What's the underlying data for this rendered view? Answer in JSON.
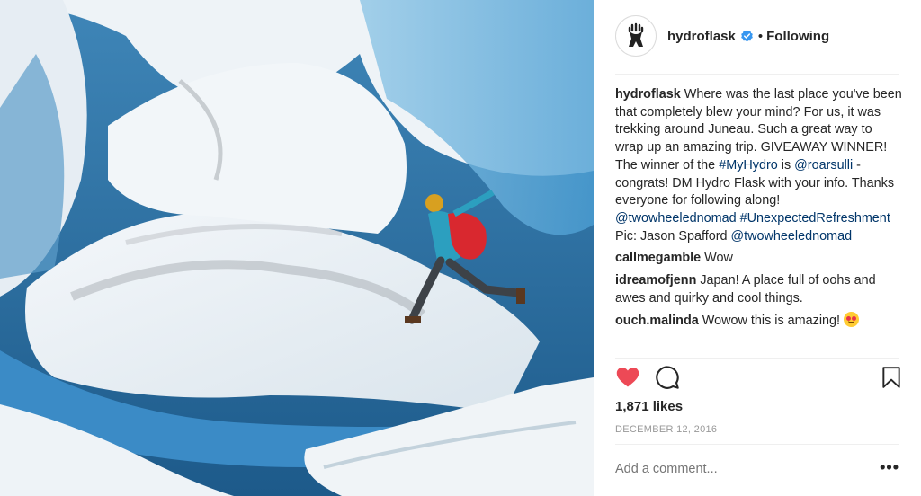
{
  "post": {
    "image_alt": "Person in a red backpack leaping across a blue glacier crevasse",
    "account": "hydroflask",
    "separator": "•",
    "follow_status": "Following"
  },
  "comments": [
    {
      "user": "hydroflask",
      "parts": [
        {
          "t": "text",
          "v": " Where was the last place you've been that completely blew your mind? For us, it was trekking around Juneau. Such a great way to wrap up an amazing trip. GIVEAWAY WINNER! The winner of the "
        },
        {
          "t": "link",
          "v": "#MyHydro"
        },
        {
          "t": "text",
          "v": " is "
        },
        {
          "t": "link",
          "v": "@roarsulli"
        },
        {
          "t": "text",
          "v": " - congrats! DM Hydro Flask with your info. Thanks everyone for following along! "
        },
        {
          "t": "link",
          "v": "@twowheelednomad"
        },
        {
          "t": "text",
          "v": " "
        },
        {
          "t": "link",
          "v": "#UnexpectedRefreshment"
        },
        {
          "t": "text",
          "v": " Pic: Jason Spafford "
        },
        {
          "t": "link",
          "v": "@twowheelednomad"
        }
      ]
    },
    {
      "user": "callmegamble",
      "parts": [
        {
          "t": "text",
          "v": " Wow"
        }
      ]
    },
    {
      "user": "idreamofjenn",
      "parts": [
        {
          "t": "text",
          "v": " Japan! A place full of oohs and awes and quirky and cool things."
        }
      ]
    },
    {
      "user": "ouch.malinda",
      "parts": [
        {
          "t": "text",
          "v": " Wowow this is amazing! "
        },
        {
          "t": "emoji",
          "v": "heart-eyes"
        }
      ]
    }
  ],
  "actions": {
    "like_icon": "heart-icon",
    "comment_icon": "comment-icon",
    "save_icon": "bookmark-icon",
    "like_color": "#ed4956"
  },
  "likes": "1,871 likes",
  "date": "DECEMBER 12, 2016",
  "add_comment_placeholder": "Add a comment...",
  "more_label": "•••"
}
